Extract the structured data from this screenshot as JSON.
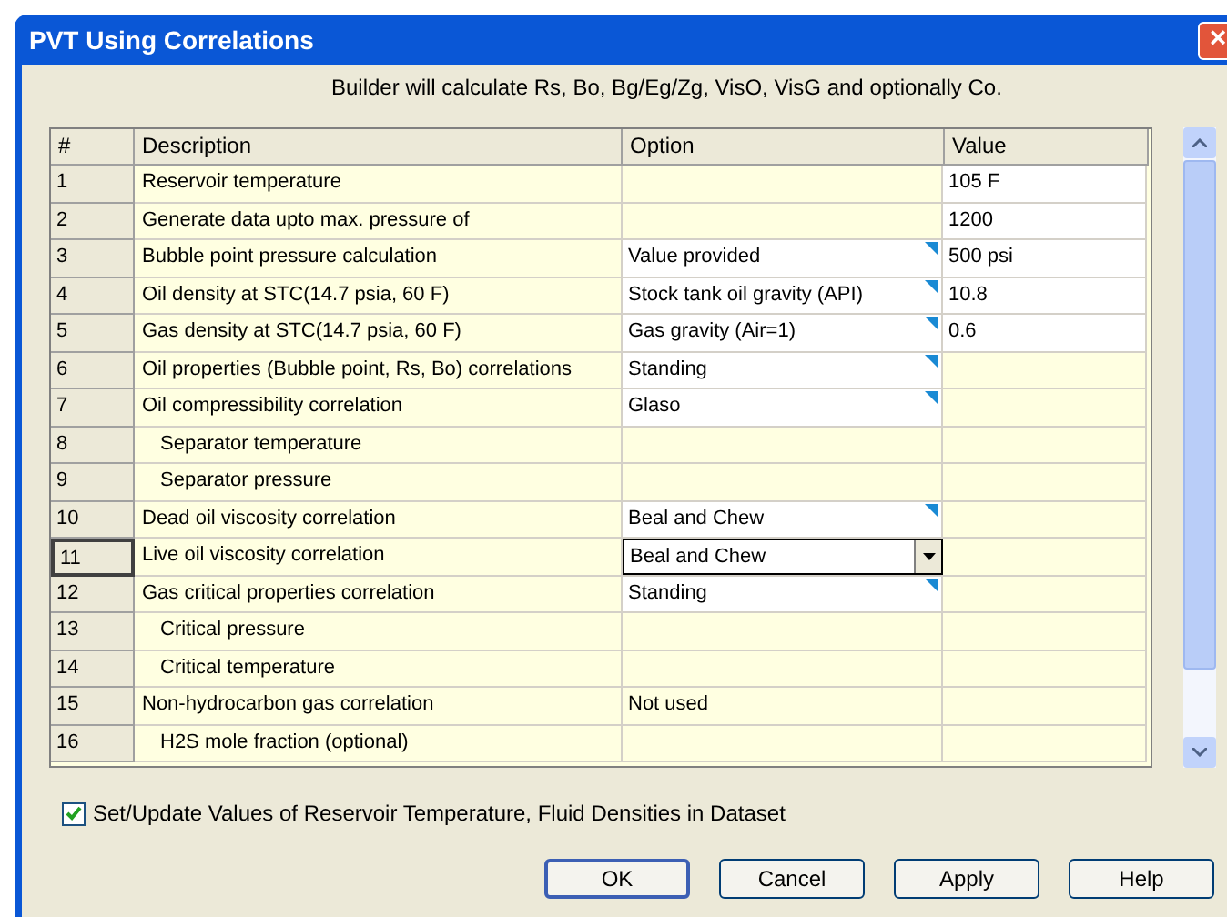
{
  "window": {
    "title": "PVT Using Correlations",
    "close": "×"
  },
  "subtitle": "Builder will calculate Rs, Bo, Bg/Eg/Zg, VisO, VisG and optionally Co.",
  "table": {
    "columns": [
      "#",
      "Description",
      "Option",
      "Value"
    ],
    "rows": [
      {
        "num": "1",
        "description": "Reservoir temperature",
        "selected": false,
        "value": {
          "text": "105 F",
          "editable": true
        }
      },
      {
        "num": "2",
        "description": "Generate data upto max. pressure of",
        "selected": false,
        "value": {
          "text": "1200",
          "editable": true
        }
      },
      {
        "num": "3",
        "description": "Bubble point pressure calculation",
        "selected": false,
        "option": {
          "text": "Value provided",
          "kind": "dropdown"
        },
        "value": {
          "text": "500 psi",
          "editable": true
        }
      },
      {
        "num": "4",
        "description": "Oil density at STC(14.7 psia, 60 F)",
        "selected": false,
        "option": {
          "text": "Stock tank oil gravity (API)",
          "kind": "dropdown"
        },
        "value": {
          "text": "10.8",
          "editable": true
        }
      },
      {
        "num": "5",
        "description": "Gas density at STC(14.7 psia, 60 F)",
        "selected": false,
        "option": {
          "text": "Gas gravity (Air=1)",
          "kind": "dropdown"
        },
        "value": {
          "text": "0.6",
          "editable": true
        }
      },
      {
        "num": "6",
        "description": "Oil properties (Bubble point, Rs, Bo) correlations",
        "selected": false,
        "option": {
          "text": "Standing",
          "kind": "dropdown"
        }
      },
      {
        "num": "7",
        "description": "Oil compressibility correlation",
        "selected": false,
        "option": {
          "text": "Glaso",
          "kind": "dropdown"
        },
        "children": [
          {
            "num": "8",
            "description": "Separator temperature",
            "selected": false
          },
          {
            "num": "9",
            "description": "Separator pressure",
            "selected": false
          }
        ]
      },
      {
        "num": "10",
        "description": "Dead oil viscosity correlation",
        "selected": false,
        "option": {
          "text": "Beal and Chew",
          "kind": "dropdown"
        }
      },
      {
        "num": "11",
        "description": "Live oil viscosity correlation",
        "selected": true,
        "option": {
          "text": "Beal and Chew",
          "kind": "combo"
        }
      },
      {
        "num": "12",
        "description": "Gas critical properties correlation",
        "selected": false,
        "option": {
          "text": "Standing",
          "kind": "dropdown"
        },
        "children": [
          {
            "num": "13",
            "description": "Critical pressure",
            "selected": false
          },
          {
            "num": "14",
            "description": "Critical temperature",
            "selected": false
          }
        ]
      },
      {
        "num": "15",
        "description": "Non-hydrocarbon gas correlation",
        "selected": false,
        "option": {
          "text": "Not used",
          "kind": "plain"
        },
        "children": [
          {
            "num": "16",
            "description": "H2S mole fraction (optional)",
            "selected": false
          }
        ]
      }
    ]
  },
  "checkbox": {
    "label": "Set/Update Values of Reservoir Temperature, Fluid Densities in Dataset",
    "checked": true
  },
  "buttons": [
    {
      "label": "OK",
      "default": true
    },
    {
      "label": "Cancel",
      "default": false
    },
    {
      "label": "Apply",
      "default": false
    },
    {
      "label": "Help",
      "default": false
    }
  ]
}
